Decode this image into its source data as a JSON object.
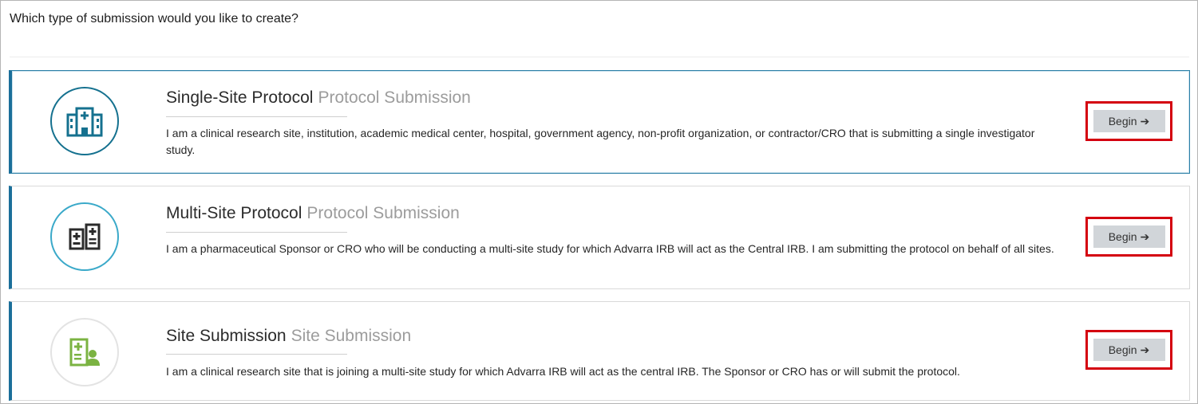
{
  "question": "Which type of submission would you like to create?",
  "cards": [
    {
      "title": "Single-Site Protocol",
      "subtitle": "Protocol Submission",
      "description": "I am a clinical research site, institution, academic medical center, hospital, government agency, non-profit organization, or contractor/CRO that is submitting a single investigator study.",
      "button_label": "Begin",
      "icon": "hospital-icon",
      "icon_color": "#15718f"
    },
    {
      "title": "Multi-Site Protocol",
      "subtitle": "Protocol Submission",
      "description": "I am a pharmaceutical Sponsor or CRO who will be conducting a multi-site study for which Advarra IRB will act as the Central IRB. I am submitting the protocol on behalf of all sites.",
      "button_label": "Begin",
      "icon": "multi-document-icon",
      "icon_color": "#2b2b2b"
    },
    {
      "title": "Site Submission",
      "subtitle": "Site Submission",
      "description": "I am a clinical research site that is joining a multi-site study for which Advarra IRB will act as the central IRB. The Sponsor or CRO has or will submit the protocol.",
      "button_label": "Begin",
      "icon": "site-user-document-icon",
      "icon_color": "#7bb342"
    }
  ],
  "colors": {
    "accent": "#1b6f9a",
    "highlight_border": "#d4000f",
    "button_bg": "#d1d5d9"
  }
}
